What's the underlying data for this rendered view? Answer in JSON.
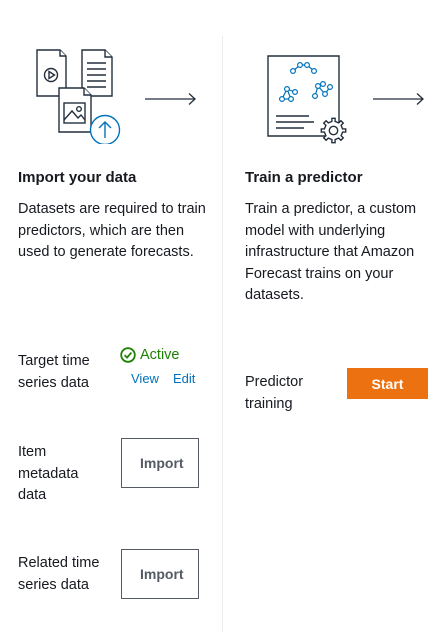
{
  "import_step": {
    "title": "Import your data",
    "description": "Datasets are required to train predictors, which are then used to generate forecasts.",
    "rows": [
      {
        "label": "Target time series data",
        "status": "Active",
        "actions": [
          "View",
          "Edit"
        ]
      },
      {
        "label": "Item metadata data",
        "button": "Import"
      },
      {
        "label": "Related time series data",
        "button": "Import"
      }
    ]
  },
  "train_step": {
    "title": "Train a predictor",
    "description": "Train a predictor, a custom model with underlying infrastructure that Amazon Forecast trains on your datasets.",
    "row": {
      "label": "Predictor training",
      "button": "Start"
    }
  },
  "icons": {
    "import_illustration": "documents-upload-illustration",
    "train_illustration": "model-gear-illustration",
    "next_arrow": "right-arrow-icon",
    "status_icon": "check-circle-icon"
  },
  "colors": {
    "status_active": "#1d8102",
    "link": "#0073bb",
    "primary_button": "#ec7211",
    "outline_button": "#545b64"
  }
}
